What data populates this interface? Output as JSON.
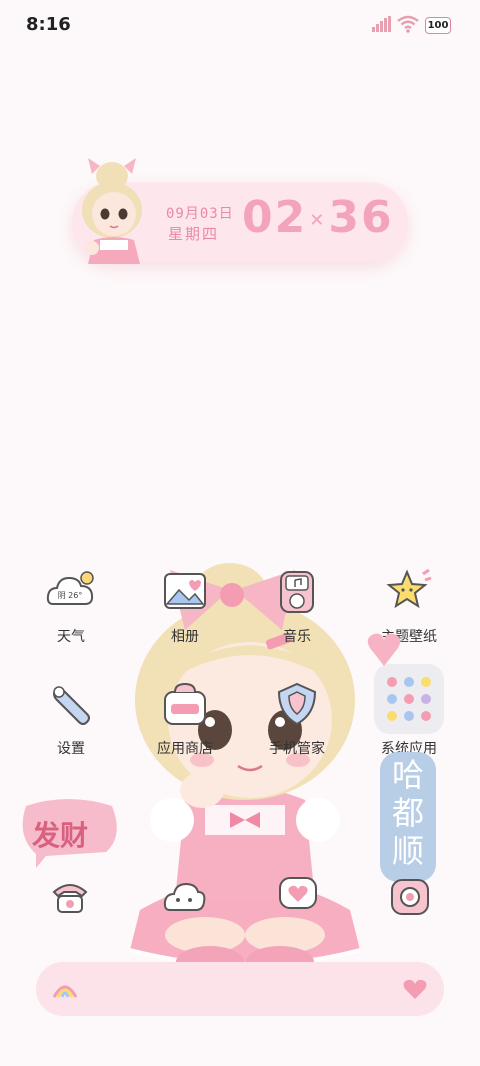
{
  "status_bar": {
    "time": "8:16",
    "battery": "100"
  },
  "clock_widget": {
    "date": "09月03日",
    "weekday": "星期四",
    "hours": "02",
    "minutes": "36"
  },
  "apps": [
    {
      "label": "天气",
      "icon": "weather-cloud-icon",
      "badge": "阴 26°"
    },
    {
      "label": "相册",
      "icon": "photo-album-icon"
    },
    {
      "label": "音乐",
      "icon": "music-player-icon"
    },
    {
      "label": "主题壁纸",
      "icon": "star-theme-icon"
    },
    {
      "label": "设置",
      "icon": "wrench-settings-icon"
    },
    {
      "label": "应用商店",
      "icon": "store-bag-icon"
    },
    {
      "label": "手机管家",
      "icon": "shield-manager-icon"
    },
    {
      "label": "系统应用",
      "icon": "app-folder-icon"
    }
  ],
  "stickers": {
    "fa_cai": "发财",
    "ha_du_shun": "哈都顺"
  },
  "dock": {
    "left_icon": "rainbow-icon",
    "right_icon": "heart-icon"
  },
  "colors": {
    "accent_pink": "#f3a3ba",
    "widget_bg": "#fde7ec",
    "dock_bg": "#fbe3e9",
    "sticker_blue": "#b8cde6"
  }
}
